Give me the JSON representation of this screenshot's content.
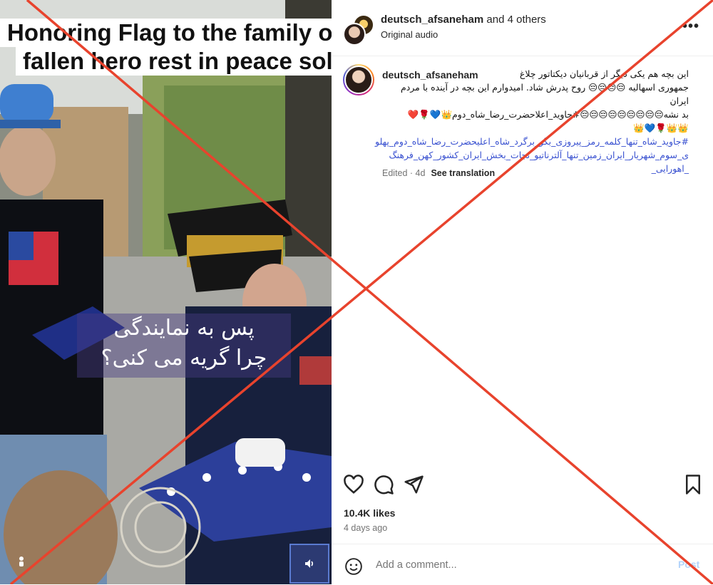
{
  "media": {
    "caption_line1": "Honoring Flag to the family of t",
    "caption_line2": "fallen hero rest in peace sold",
    "subtitle_line1": "پس به نمایندگی",
    "subtitle_line2": "چرا گریه می کنی؟"
  },
  "header": {
    "username": "deutsch_afsaneham",
    "others": " and 4 others",
    "audio": "Original audio",
    "more": "•••"
  },
  "post": {
    "username": "deutsch_afsaneham",
    "caption_lines": [
      "این بچه هم یکی دیگر از قربانیان دیکتاتور چلاغ",
      "جمهوری اسهالیه 😔😔😔😔 روح پدرش شاد. امیدوارم این بچه در آینده با مردم ایران",
      "بد نشه😔😔😔😔😔😔😔😔😔#جاوید_اعلاحضرت_رضا_شاه_دوم👑💙🌹❤️",
      "👑👑🌹💙👑"
    ],
    "hashtags_lines": [
      "#جاوید_شاه_تنها_کلمه_رمز_پیروزی_بگو_برگرد_شاه_اعلیحضرت_رضا_شاه_دوم_پهلو",
      "ی_سوم_شهریار_ایران_زمین_تنها_آلترناتیو_نجات_بخش_ایران_کشور_کهن_فرهنگ",
      "_اهورایی_"
    ],
    "edited": "Edited · 4d",
    "see_translation": "See translation"
  },
  "stats": {
    "likes": "10.4K likes",
    "age": "4 days ago"
  },
  "comment": {
    "placeholder": "Add a comment...",
    "post_label": "Post"
  },
  "icons": [
    "heart-icon",
    "comment-icon",
    "share-icon",
    "bookmark-icon",
    "emoji-icon",
    "speaker-icon",
    "more-icon"
  ],
  "colors": {
    "x_mark": "#e8432d",
    "hashtag": "#3850d0",
    "post_button": "#b3d4fb"
  }
}
